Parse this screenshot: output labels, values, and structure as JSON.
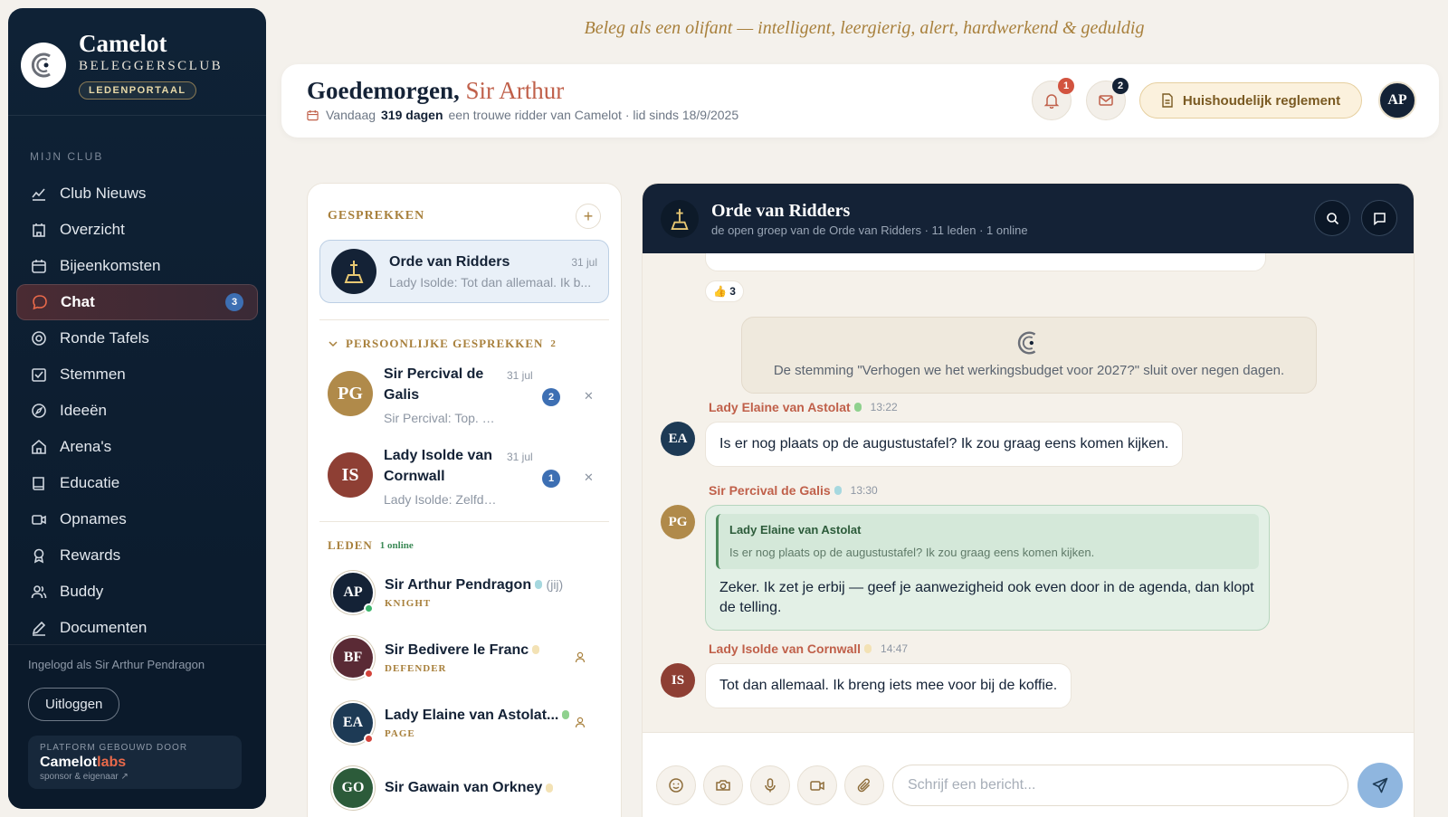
{
  "motto": "Beleg als een olifant — intelligent, leergierig, alert, hardwerkend & geduldig",
  "brand": {
    "name": "Camelot",
    "sub": "BELEGGERSCLUB",
    "badge": "LEDENPORTAAL"
  },
  "sidebar": {
    "section": "MIJN CLUB",
    "items": [
      {
        "label": "Club Nieuws",
        "icon": "chart-line-icon"
      },
      {
        "label": "Overzicht",
        "icon": "building-icon"
      },
      {
        "label": "Bijeenkomsten",
        "icon": "calendar-icon"
      },
      {
        "label": "Chat",
        "icon": "chat-bubble-icon",
        "badge": "3",
        "active": true
      },
      {
        "label": "Ronde Tafels",
        "icon": "target-icon"
      },
      {
        "label": "Stemmen",
        "icon": "vote-box-icon"
      },
      {
        "label": "Ideeën",
        "icon": "compass-icon"
      },
      {
        "label": "Arena's",
        "icon": "home-icon"
      },
      {
        "label": "Educatie",
        "icon": "book-icon"
      },
      {
        "label": "Opnames",
        "icon": "video-icon"
      },
      {
        "label": "Rewards",
        "icon": "award-icon"
      },
      {
        "label": "Buddy",
        "icon": "users-icon"
      },
      {
        "label": "Documenten",
        "icon": "pen-icon"
      }
    ],
    "logged_in": "Ingelogd als Sir Arthur Pendragon",
    "logout": "Uitloggen",
    "powered_label": "PLATFORM GEBOUWD DOOR",
    "powered_name_a": "Camelot",
    "powered_name_b": "labs",
    "powered_sub": "sponsor & eigenaar ↗"
  },
  "header": {
    "greeting": "Goedemorgen,",
    "name": "Sir Arthur",
    "today": "Vandaag",
    "days": "319 dagen",
    "since": "een trouwe ridder van Camelot · lid sinds 18/9/2025",
    "notif_count": "1",
    "mail_count": "2",
    "reglement": "Huishoudelijk reglement",
    "avatar": "AP"
  },
  "conversations": {
    "title": "GESPREKKEN",
    "add": "+",
    "group": {
      "name": "Orde van Ridders",
      "date": "31 jul",
      "preview": "Lady Isolde: Tot dan allemaal. Ik b..."
    },
    "personal_title": "PERSOONLIJKE GESPREKKEN",
    "personal_count": "2",
    "personal": [
      {
        "initials": "PG",
        "name": "Sir Percival de Galis",
        "date": "31 jul",
        "preview": "Sir Percival: Top. En ver...",
        "badge": "2",
        "color": "#b08a4a"
      },
      {
        "initials": "IS",
        "name": "Lady Isolde van Cornwall",
        "date": "31 jul",
        "preview": "Lady Isolde: Zelfde ge...",
        "badge": "1",
        "color": "#8e3f34"
      }
    ],
    "members_title": "LEDEN",
    "members_online": "1 online",
    "members": [
      {
        "initials": "AP",
        "name": "Sir Arthur Pendragon",
        "you": "(jij)",
        "role": "KNIGHT",
        "color": "#142236",
        "status": "#3bb36a",
        "gem": "#a6d8df"
      },
      {
        "initials": "BF",
        "name": "Sir Bedivere le Franc",
        "you": "",
        "role": "DEFENDER",
        "color": "#5a2a35",
        "status": "#d2433b",
        "gem": "#f3e2b5"
      },
      {
        "initials": "EA",
        "name": "Lady Elaine van Astolat...",
        "you": "",
        "role": "PAGE",
        "color": "#1d3a55",
        "status": "#d2433b",
        "gem": "#8fd18e"
      },
      {
        "initials": "GO",
        "name": "Sir Gawain van Orkney",
        "you": "",
        "role": "",
        "color": "#2c5b3a",
        "status": "#d2433b",
        "gem": "#f3e2b5"
      }
    ]
  },
  "chat": {
    "title": "Orde van Ridders",
    "subtitle": "de open groep van de Orde van Ridders · 11 leden · 1 online",
    "reaction": "👍 3",
    "system_text": "De stemming \"Verhogen we het werkingsbudget voor 2027?\" sluit over negen dagen.",
    "messages": [
      {
        "initials": "EA",
        "author": "Lady Elaine van Astolat",
        "time": "13:22",
        "text": "Is er nog plaats op de augustustafel? Ik zou graag eens komen kijken."
      },
      {
        "initials": "PG",
        "author": "Sir Percival de Galis",
        "time": "13:30",
        "quote_author": "Lady Elaine van Astolat",
        "quote_text": "Is er nog plaats op de augustustafel? Ik zou graag eens komen kijken.",
        "text": "Zeker. Ik zet je erbij — geef je aanwezigheid ook even door in de agenda, dan klopt de telling."
      },
      {
        "initials": "IS",
        "author": "Lady Isolde van Cornwall",
        "time": "14:47",
        "text": "Tot dan allemaal. Ik breng iets mee voor bij de koffie."
      }
    ],
    "placeholder": "Schrijf een bericht..."
  }
}
